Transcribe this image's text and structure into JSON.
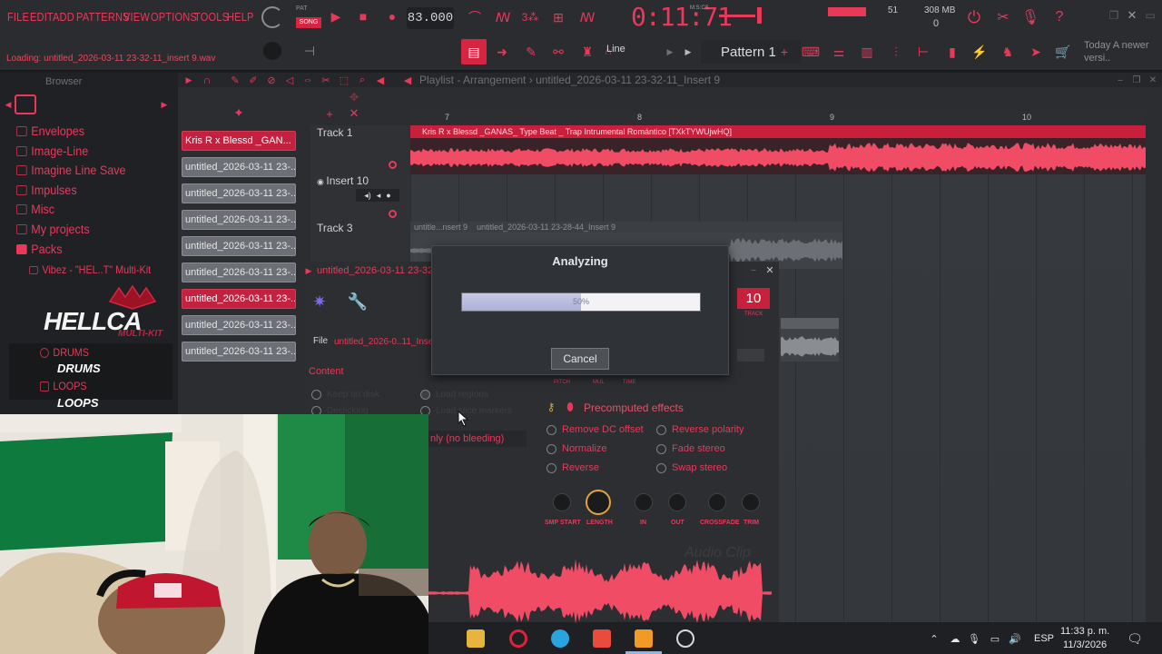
{
  "menu": [
    "FILE",
    "EDIT",
    "ADD",
    "PATTERNS",
    "VIEW",
    "OPTIONS",
    "TOOLS",
    "HELP"
  ],
  "transport": {
    "pat_label": "PAT",
    "song_label": "SONG",
    "bpm": "83.000",
    "time": "0:11:71",
    "time_label": "M:S:CS"
  },
  "status": {
    "loading": "Loading: untitled_2026-03-11 23-32-11_insert 9.wav",
    "cpu": "51",
    "ram": "308 MB",
    "ram_sub": "0"
  },
  "toolbar": {
    "snap": "Line",
    "pattern": "Pattern 1",
    "hint": "Today  A newer versi.."
  },
  "browser": {
    "title": "Browser",
    "items": [
      "Envelopes",
      "Image-Line",
      "Imagine Line Save",
      "Impulses",
      "Misc",
      "My projects",
      "Packs"
    ],
    "sub_item": "Vibez - \"HEL..T\" Multi-Kit",
    "logo": "HELLCA",
    "logo_sub": "MULTI-KIT",
    "kit": [
      {
        "label": "DRUMS",
        "art": "DRUMS"
      },
      {
        "label": "LOOPS",
        "art": "LOOPS"
      }
    ]
  },
  "channels": [
    {
      "label": "Kris R x Blessd _GAN...",
      "active": true
    },
    {
      "label": "untitled_2026-03-11 23-...",
      "active": false
    },
    {
      "label": "untitled_2026-03-11 23-...",
      "active": false
    },
    {
      "label": "untitled_2026-03-11 23-...",
      "active": false
    },
    {
      "label": "untitled_2026-03-11 23-...",
      "active": false
    },
    {
      "label": "untitled_2026-03-11 23-...",
      "active": false
    },
    {
      "label": "untitled_2026-03-11 23-...",
      "active": true
    },
    {
      "label": "untitled_2026-03-11 23-...",
      "active": false
    },
    {
      "label": "untitled_2026-03-11 23-...",
      "active": false
    }
  ],
  "playlist": {
    "title": "Playlist - Arrangement",
    "path": "untitled_2026-03-11 23-32-11_Insert 9",
    "ruler": [
      "7",
      "8",
      "9",
      "10"
    ],
    "tracks": [
      "Track 1",
      "Insert 10",
      "Track 3"
    ],
    "clip_main": "Kris R x Blessd _GANAS_ Type Beat _ Trap Intrumental Romántico [TXkTYWUjwHQ]",
    "clip_a": "untitle...nsert 9",
    "clip_b": "untitled_2026-03-11 23-28-44_Insert 9"
  },
  "clip_settings": {
    "title": "untitled_2026-03-11 23-32",
    "file_label": "File",
    "file_name": "untitled_2026-0..11_Insert",
    "track_num": "10",
    "track_label": "TRACK",
    "content_label": "Content",
    "content_opts": [
      "Keep on disk",
      "Load regions",
      "Declicking",
      "Load slice markers"
    ],
    "bleed": "nly (no bleeding)",
    "env_labels": [
      "PITCH",
      "MUL",
      "TIME"
    ],
    "effects_title": "Precomputed effects",
    "effects_left": [
      "Remove DC offset",
      "Normalize",
      "Reverse"
    ],
    "effects_right": [
      "Reverse polarity",
      "Fade stereo",
      "Swap stereo"
    ],
    "knobs": [
      "SMP START",
      "LENGTH",
      "IN",
      "OUT",
      "CROSSFADE",
      "TRIM"
    ],
    "watermark": "Audio Clip"
  },
  "modal": {
    "title": "Analyzing",
    "progress_pct": 50,
    "progress_label": "50%",
    "cancel": "Cancel"
  },
  "taskbar": {
    "time": "11:33 p. m.",
    "date": "11/3/2026",
    "lang": "ESP"
  },
  "colors": {
    "accent": "#e8395a",
    "clip_red": "#c81f3d",
    "wave": "#f04c66"
  }
}
